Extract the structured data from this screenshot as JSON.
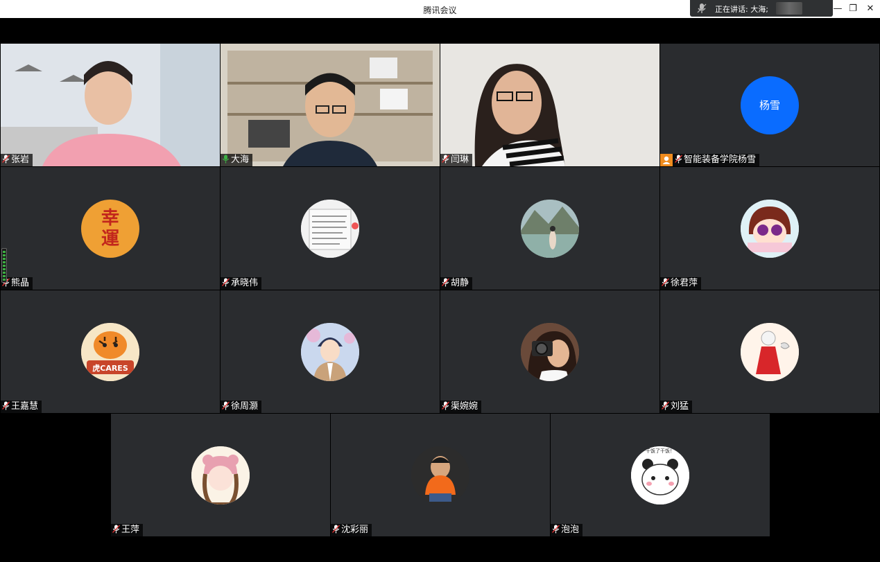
{
  "window": {
    "title": "腾讯会议"
  },
  "speaking": {
    "label": "正在讲话: 大海;"
  },
  "participants": [
    {
      "name": "张岩",
      "mic": "muted",
      "display": "video",
      "avatar_icon": "woman-pink-sweater-video"
    },
    {
      "name": "大海",
      "mic": "active",
      "display": "video",
      "avatar_icon": "man-glasses-bookshelf-video"
    },
    {
      "name": "闫琳",
      "mic": "muted",
      "display": "video",
      "avatar_icon": "woman-glasses-striped-video"
    },
    {
      "name": "智能装备学院杨雪",
      "mic": "muted",
      "display": "avatar-text",
      "avatar_text": "杨雪",
      "host_badge": true
    },
    {
      "name": "熊晶",
      "mic": "muted",
      "display": "avatar-image",
      "avatar_icon": "xingyun-calligraphy-avatar",
      "avatar_glyphs": "幸運"
    },
    {
      "name": "承晓伟",
      "mic": "muted",
      "display": "avatar-image",
      "avatar_icon": "handwritten-note-avatar"
    },
    {
      "name": "胡静",
      "mic": "muted",
      "display": "avatar-image",
      "avatar_icon": "lake-mountain-avatar"
    },
    {
      "name": "徐君萍",
      "mic": "muted",
      "display": "avatar-image",
      "avatar_icon": "cartoon-girl-sunglasses-avatar"
    },
    {
      "name": "王嘉慧",
      "mic": "muted",
      "display": "avatar-image",
      "avatar_icon": "tiger-cares-avatar",
      "avatar_glyphs": "虎CARES"
    },
    {
      "name": "徐周灏",
      "mic": "muted",
      "display": "avatar-image",
      "avatar_icon": "anime-boy-avatar"
    },
    {
      "name": "渠婉婉",
      "mic": "muted",
      "display": "avatar-image",
      "avatar_icon": "camera-girl-avatar"
    },
    {
      "name": "刘猛",
      "mic": "muted",
      "display": "avatar-image",
      "avatar_icon": "red-dress-cartoon-avatar"
    },
    {
      "name": "王萍",
      "mic": "muted",
      "display": "avatar-image",
      "avatar_icon": "bear-hat-girl-avatar"
    },
    {
      "name": "沈彩丽",
      "mic": "muted",
      "display": "avatar-image",
      "avatar_icon": "child-orange-jacket-avatar"
    },
    {
      "name": "泡泡",
      "mic": "muted",
      "display": "avatar-image",
      "avatar_icon": "panda-bear-sticker-avatar",
      "avatar_glyphs": "干饭了干饭！"
    }
  ],
  "colors": {
    "tile_bg": "#2a2c2f",
    "mic_active": "#3cb043",
    "host_badge": "#f08c1e",
    "avatar_blue": "#0a6cff"
  }
}
